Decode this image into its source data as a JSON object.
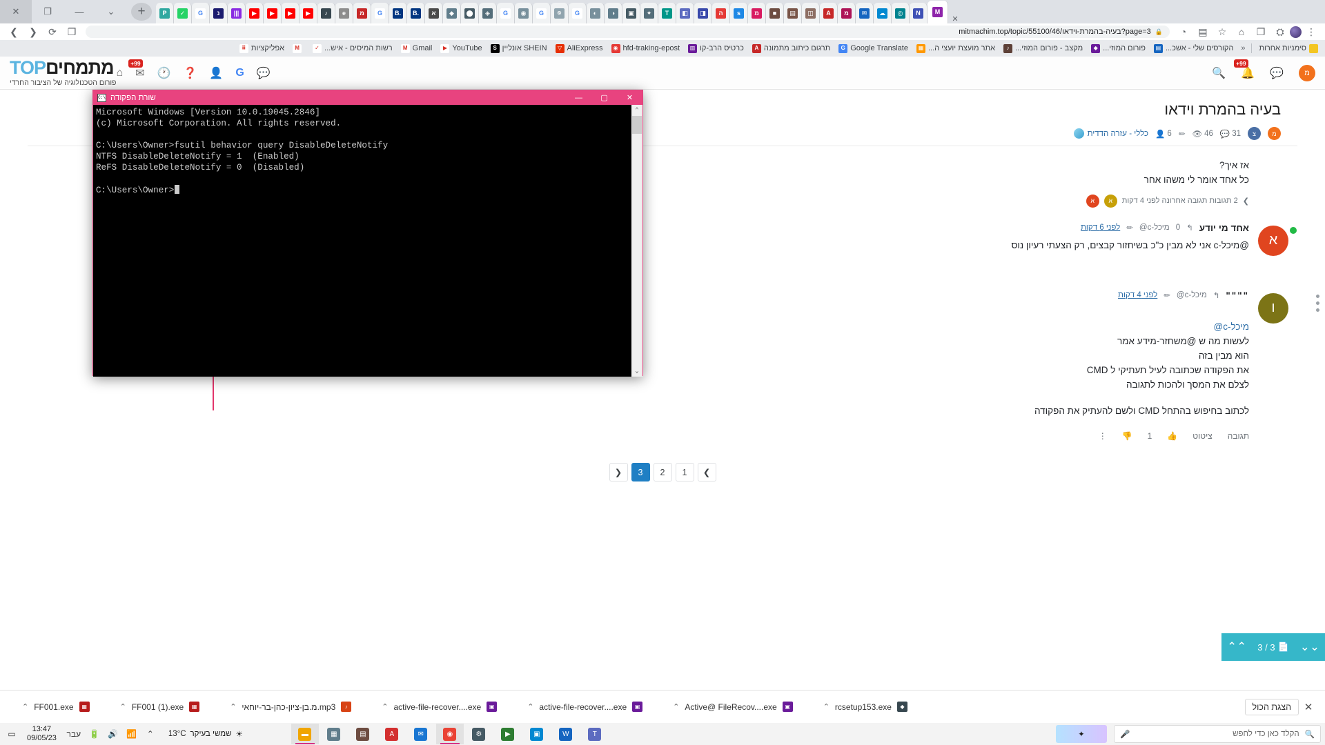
{
  "browser": {
    "window_controls": [
      "✕",
      "❐",
      "—",
      "⌄"
    ],
    "new_tab_label": "+",
    "tabs": [
      {
        "favicon_text": "P",
        "color": "#2fa8a0"
      },
      {
        "favicon_text": "✓",
        "color": "#25d366"
      },
      {
        "favicon_text": "G",
        "color": "#ffffff"
      },
      {
        "favicon_text": "נ",
        "color": "#1a1a6e"
      },
      {
        "favicon_text": "|||",
        "color": "#8a2be2"
      },
      {
        "favicon_text": "▶",
        "color": "#ff0000"
      },
      {
        "favicon_text": "▶",
        "color": "#ff0000"
      },
      {
        "favicon_text": "▶",
        "color": "#ff0000"
      },
      {
        "favicon_text": "▶",
        "color": "#ff0000"
      },
      {
        "favicon_text": "♪",
        "color": "#37474f"
      },
      {
        "favicon_text": "e",
        "color": "#8d8d8d"
      },
      {
        "favicon_text": "מ",
        "color": "#c62828"
      },
      {
        "favicon_text": "G",
        "color": "#ffffff"
      },
      {
        "favicon_text": "B.",
        "color": "#003580"
      },
      {
        "favicon_text": "B.",
        "color": "#003580"
      },
      {
        "favicon_text": "א",
        "color": "#4a4a4a"
      },
      {
        "favicon_text": "◆",
        "color": "#607d8b"
      },
      {
        "favicon_text": "⬤",
        "color": "#455a64"
      },
      {
        "favicon_text": "◈",
        "color": "#546e7a"
      },
      {
        "favicon_text": "G",
        "color": "#ffffff"
      },
      {
        "favicon_text": "◉",
        "color": "#78909c"
      },
      {
        "favicon_text": "G",
        "color": "#ffffff"
      },
      {
        "favicon_text": "⌾",
        "color": "#90a4ae"
      },
      {
        "favicon_text": "G",
        "color": "#ffffff"
      },
      {
        "favicon_text": "◐",
        "color": "#78909c"
      },
      {
        "favicon_text": "◑",
        "color": "#607d8b"
      },
      {
        "favicon_text": "▣",
        "color": "#455a64"
      },
      {
        "favicon_text": "✦",
        "color": "#546e7a"
      },
      {
        "favicon_text": "T",
        "color": "#009688"
      },
      {
        "favicon_text": "◧",
        "color": "#5c6bc0"
      },
      {
        "favicon_text": "◨",
        "color": "#3949ab"
      },
      {
        "favicon_text": "ה",
        "color": "#e53935"
      },
      {
        "favicon_text": "s",
        "color": "#1e88e5"
      },
      {
        "favicon_text": "מ",
        "color": "#d81b60"
      },
      {
        "favicon_text": "■",
        "color": "#6d4c41"
      },
      {
        "favicon_text": "▤",
        "color": "#795548"
      },
      {
        "favicon_text": "◫",
        "color": "#8d6e63"
      },
      {
        "favicon_text": "A",
        "color": "#c62828"
      },
      {
        "favicon_text": "מ",
        "color": "#ad1457"
      },
      {
        "favicon_text": "✉",
        "color": "#1565c0"
      },
      {
        "favicon_text": "☁",
        "color": "#0288d1"
      },
      {
        "favicon_text": "◎",
        "color": "#00838f"
      },
      {
        "favicon_text": "N",
        "color": "#3f51b5"
      },
      {
        "favicon_text": "M",
        "color": "#8e24aa"
      }
    ],
    "toolbar": {
      "url": "mitmachim.top/topic/55100/46/בעיה-בהמרת-וידאו?page=3",
      "lock_icon": "🔒",
      "back_icon": "❯",
      "forward_icon": "❮",
      "reload_icon": "⟳",
      "home_icon": "⌂",
      "bookmark_star_icon": "☆",
      "extensions_icon": "⛭",
      "split_icon": "❐",
      "menu_icon": "⋮"
    },
    "bookmarks": {
      "other_label": "סימניות אחרות",
      "chevron": "«",
      "items": [
        {
          "label": "הקורסים שלי - אשכ...",
          "color": "#1565c0",
          "ico": "▤"
        },
        {
          "label": "פורום המוזי...",
          "color": "#6a1b9a",
          "ico": "◆"
        },
        {
          "label": "מקצב - פורום המוזי...",
          "color": "#5d4037",
          "ico": "♪"
        },
        {
          "label": "אתר מועצת יועצי ה...",
          "color": "#ff9800",
          "ico": "▦"
        },
        {
          "label": "Google Translate",
          "color": "#4285f4",
          "ico": "G"
        },
        {
          "label": "תרגום כיתוב מתמונה",
          "color": "#c62828",
          "ico": "A"
        },
        {
          "label": "כרטיס הרב-קו",
          "color": "#6a1b9a",
          "ico": "▥"
        },
        {
          "label": "hfd-traking-epost",
          "color": "#e53935",
          "ico": "◉"
        },
        {
          "label": "AliExpress",
          "color": "#e62e04",
          "ico": "▽"
        },
        {
          "label": "SHEIN אונליין",
          "color": "#000000",
          "ico": "S"
        },
        {
          "label": "YouTube",
          "color": "#ffffff",
          "ico": "▶"
        },
        {
          "label": "Gmail",
          "color": "#ffffff",
          "ico": "M"
        },
        {
          "label": "רשות המיסים - איש...",
          "color": "#ffffff",
          "ico": "✓"
        },
        {
          "label": "",
          "color": "#ffffff",
          "ico": "M"
        },
        {
          "label": "אפליקציות",
          "color": "#ffffff",
          "ico": "⠿"
        }
      ]
    }
  },
  "site": {
    "brand_main": "מתמחים",
    "brand_top": "TOP",
    "brand_sub": "פורום הטכנולוגיה של הציבור החרדי",
    "header_icons": [
      {
        "name": "chat-icon",
        "glyph": "💬"
      },
      {
        "name": "google-icon",
        "glyph": "G"
      },
      {
        "name": "user-icon",
        "glyph": "👤"
      },
      {
        "name": "help-icon",
        "glyph": "?"
      },
      {
        "name": "history-icon",
        "glyph": "🕐"
      },
      {
        "name": "inbox-icon",
        "glyph": "✉",
        "badge": "99+"
      },
      {
        "name": "home-icon",
        "glyph": "⌂"
      }
    ],
    "left_icons": [
      {
        "name": "avatar-icon",
        "glyph": "מ"
      },
      {
        "name": "comment-icon",
        "glyph": "💬"
      },
      {
        "name": "bell-icon",
        "glyph": "🔔",
        "badge": "99+"
      },
      {
        "name": "search-icon",
        "glyph": "🔍"
      }
    ]
  },
  "topic": {
    "title": "בעיה בהמרת וידאו",
    "category": "כללי - עזרה הדדית",
    "stats": {
      "posts_count": "31",
      "views_count": "46",
      "users_count": "6"
    },
    "meta_avatars": [
      {
        "letter": "מ",
        "color": "#f2711c"
      },
      {
        "letter": "צ",
        "color": "#4a6fa5"
      }
    ]
  },
  "posts": [
    {
      "id": "post-0",
      "lines": [
        "אז איך?",
        "כל אחד אומר לי משהו אחר"
      ],
      "collapsed_label": "2 תגובות תגובה אחרונה לפני 4 דקות",
      "collapsed_chevron": "❯",
      "collapsed_avatars": [
        {
          "letter": "א",
          "color": "#c7a008"
        },
        {
          "letter": "א",
          "color": "#e0451f"
        }
      ]
    },
    {
      "id": "post-1",
      "author": "אחד מי יודע",
      "votes": "0",
      "reply_to": "מיכל-c@",
      "reply_icon": "↰",
      "edit_icon": "✏",
      "time": "לפני 6 דקות",
      "avatar_letter": "א",
      "avatar_color": "#e0451f",
      "online": true,
      "body": "@מיכל-c אני לא מבין כ\"כ בשיחזור קבצים, רק הצעתי רעיון נוס"
    },
    {
      "id": "post-2",
      "author": "\"\"\"\"",
      "votes": "",
      "reply_to": "מיכל-c@",
      "reply_icon": "↰",
      "edit_icon": "✏",
      "time": "לפני 4 דקות",
      "avatar_letter": "ו",
      "avatar_color": "#7c7416",
      "online": false,
      "mention": "מיכל-c@",
      "lines": [
        "לעשות מה ש @משחזר-מידע אמר",
        "הוא מבין בזה",
        "את הפקודה שכתובה לעיל תעתיקי ל CMD",
        "לצלם את המסך ולהכות לתגובה"
      ],
      "last_line": "לכתוב בחיפוש בהתחל CMD ולשם להעתיק את הפקודה"
    }
  ],
  "post_actions": {
    "reply_label": "תגובה",
    "quote_label": "ציטוט",
    "upvote_icon": "👍",
    "vote_count": "1",
    "downvote_icon": "👎",
    "more_icon": "⋮"
  },
  "pagination": {
    "prev_icon": "❮",
    "next_icon": "❯",
    "pages": [
      "1",
      "2",
      "3"
    ],
    "current": "3"
  },
  "scroll_widget": {
    "down_icon": "⌄⌄",
    "position_label": "3 / 3",
    "page_icon": "📄",
    "up_icon": "⌃⌃"
  },
  "cmd": {
    "title": "שורת הפקודה",
    "icon_text": "C:\\",
    "minimize": "—",
    "maximize": "❐",
    "close": "✕",
    "scroll_up_arrow": "⌃",
    "scroll_down_arrow": "⌄",
    "lines": [
      "Microsoft Windows [Version 10.0.19045.2846]",
      "(c) Microsoft Corporation. All rights reserved.",
      "",
      "C:\\Users\\Owner>fsutil behavior query DisableDeleteNotify",
      "NTFS DisableDeleteNotify = 1  (Enabled)",
      "ReFS DisableDeleteNotify = 0  (Disabled)",
      ""
    ],
    "prompt": "C:\\Users\\Owner>"
  },
  "taskbar_thumbs": {
    "close_icon": "✕",
    "present_label": "הצגת הכול",
    "chevron": "⌃",
    "items": [
      {
        "label": "FF001.exe",
        "color": "#b71c1c",
        "ico": "▦"
      },
      {
        "label": "FF001 (1).exe",
        "color": "#b71c1c",
        "ico": "▦"
      },
      {
        "label": "מ.בן-ציון-כהן-בר-יוחאי.mp3",
        "color": "#d84315",
        "ico": "♪"
      },
      {
        "label": "active-file-recover....exe",
        "color": "#6a1b9a",
        "ico": "▣"
      },
      {
        "label": "active-file-recover....exe",
        "color": "#6a1b9a",
        "ico": "▣"
      },
      {
        "label": "Active@ FileRecov....exe",
        "color": "#6a1b9a",
        "ico": "▣"
      },
      {
        "label": "rcsetup153.exe",
        "color": "#37474f",
        "ico": "◆"
      }
    ]
  },
  "system_taskbar": {
    "clock_time": "13:47",
    "clock_date": "09/05/23",
    "language": "עבר",
    "weather_temp": "13°C",
    "weather_text": "שמשי בעיקר",
    "search_placeholder": "הקלד כאן כדי לחפש",
    "search_icon": "🔍",
    "mic_icon": "🎤",
    "copilot_icon": "✦",
    "sys_icons": [
      "🔋",
      "🔊",
      "📶",
      "⌃"
    ],
    "apps": [
      {
        "name": "file-explorer",
        "ico": "▬",
        "color": "#f0a500",
        "active": true
      },
      {
        "name": "calculator",
        "ico": "▦",
        "color": "#607d8b",
        "active": false
      },
      {
        "name": "folder",
        "ico": "▤",
        "color": "#6d4c41",
        "active": false
      },
      {
        "name": "app-a",
        "ico": "A",
        "color": "#d32f2f",
        "active": false
      },
      {
        "name": "mail",
        "ico": "✉",
        "color": "#1976d2",
        "active": false
      },
      {
        "name": "chrome",
        "ico": "◉",
        "color": "#ea4335",
        "active": true
      },
      {
        "name": "settings",
        "ico": "⚙",
        "color": "#455a64",
        "active": false
      },
      {
        "name": "media-player",
        "ico": "▶",
        "color": "#2e7d32",
        "active": false
      },
      {
        "name": "photos",
        "ico": "▣",
        "color": "#0288d1",
        "active": false
      },
      {
        "name": "word",
        "ico": "W",
        "color": "#1565c0",
        "active": false
      },
      {
        "name": "teams",
        "ico": "T",
        "color": "#5c6bc0",
        "active": false
      }
    ]
  }
}
